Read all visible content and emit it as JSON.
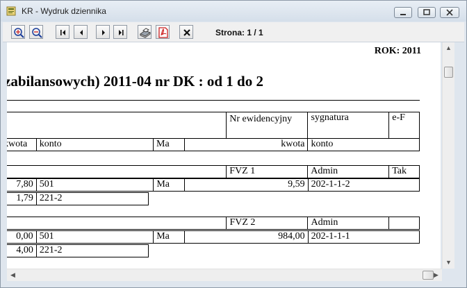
{
  "window": {
    "title": "KR - Wydruk dziennika"
  },
  "toolbar": {
    "buttons": [
      "zoom-in-icon",
      "zoom-out-icon",
      "first-page-icon",
      "prev-page-icon",
      "next-page-icon",
      "last-page-icon",
      "print-icon",
      "pdf-icon",
      "close-icon"
    ],
    "page_label": "Strona: 1 / 1"
  },
  "document": {
    "year_label": "ROK: 2011",
    "heading": "zabilansowych)  2011-04    nr DK : od 1 do 2",
    "header_table": {
      "row1": [
        "",
        "Nr ewidencyjny",
        "sygnatura",
        "e-F"
      ],
      "row2": [
        "kwota",
        "konto",
        "Ma",
        "kwota",
        "konto"
      ]
    },
    "entries": [
      {
        "nr": "FVZ 1",
        "sygnatura": "Admin",
        "ef": "Tak",
        "lines": [
          {
            "kwota": "7,80",
            "konto": "501",
            "ma": "Ma",
            "kwota2": "9,59",
            "konto2": "202-1-1-2"
          },
          {
            "kwota": "1,79",
            "konto": "221-2"
          }
        ]
      },
      {
        "nr": "FVZ 2",
        "sygnatura": "Admin",
        "ef": "",
        "lines": [
          {
            "kwota": "0,00",
            "konto": "501",
            "ma": "Ma",
            "kwota2": "984,00",
            "konto2": "202-1-1-1"
          },
          {
            "kwota": "4,00",
            "konto": "221-2"
          }
        ]
      }
    ]
  },
  "colors": {
    "titlebar": "#d5dfea",
    "pdf_icon": "#cc2222"
  }
}
